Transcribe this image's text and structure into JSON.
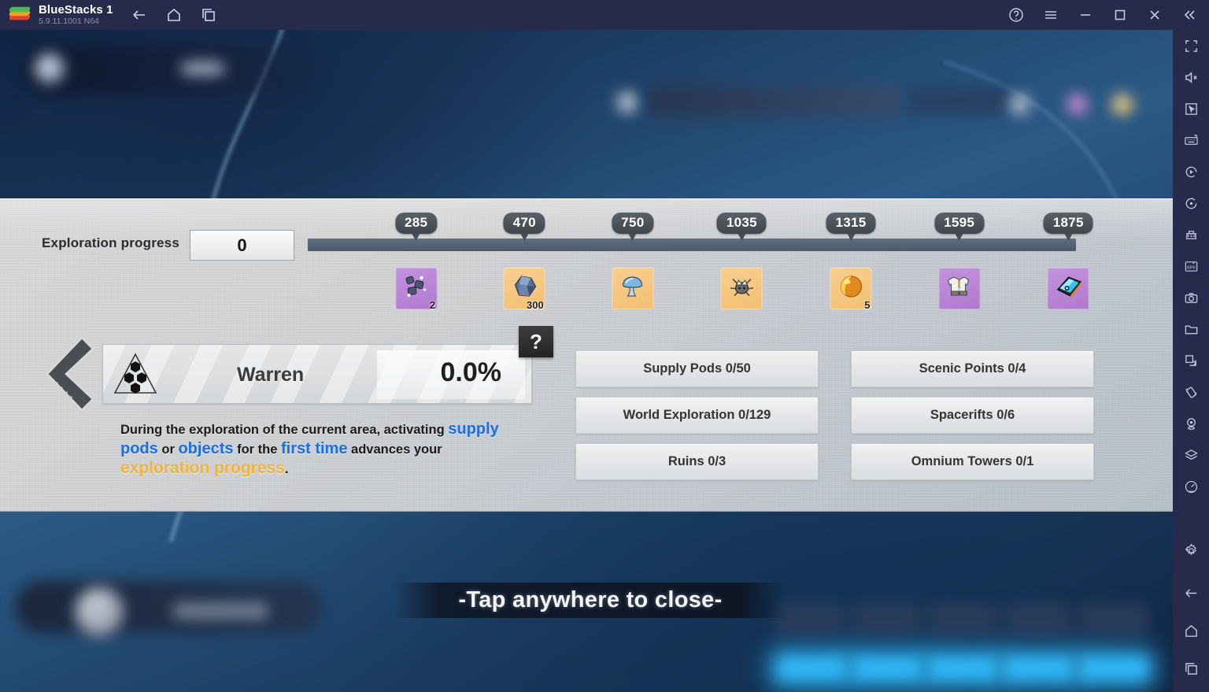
{
  "titlebar": {
    "app_name": "BlueStacks 1",
    "version": "5.9.11.1001 N64",
    "nav": [
      {
        "name": "back-icon",
        "label": "Back"
      },
      {
        "name": "home-icon",
        "label": "Home"
      },
      {
        "name": "recents-icon",
        "label": "Recent apps"
      }
    ],
    "controls": [
      {
        "name": "help-icon",
        "label": "Help"
      },
      {
        "name": "menu-icon",
        "label": "Menu"
      },
      {
        "name": "minimize-icon",
        "label": "Minimize"
      },
      {
        "name": "maximize-icon",
        "label": "Maximize"
      },
      {
        "name": "close-icon",
        "label": "Close"
      },
      {
        "name": "collapse-sidebar-icon",
        "label": "Collapse"
      }
    ]
  },
  "sidebar": {
    "items": [
      {
        "name": "fullscreen-icon",
        "label": "Fullscreen"
      },
      {
        "name": "mute-icon",
        "label": "Mute"
      },
      {
        "name": "cursor-icon",
        "label": "Cursor"
      },
      {
        "name": "keyboard-controls-icon",
        "label": "Game controls"
      },
      {
        "name": "macro-recorder-icon",
        "label": "Macro recorder"
      },
      {
        "name": "rotate-icon",
        "label": "Rotate"
      },
      {
        "name": "multi-instance-icon",
        "label": "Multi-instance"
      },
      {
        "name": "install-apk-icon",
        "label": "Install APK"
      },
      {
        "name": "screenshot-icon",
        "label": "Screenshot"
      },
      {
        "name": "media-manager-icon",
        "label": "Media manager"
      },
      {
        "name": "copy-icon",
        "label": "Copy to PC"
      },
      {
        "name": "shake-icon",
        "label": "Shake"
      },
      {
        "name": "location-icon",
        "label": "Location"
      },
      {
        "name": "layers-icon",
        "label": "Layers"
      },
      {
        "name": "performance-icon",
        "label": "Performance"
      },
      {
        "name": "settings-icon",
        "label": "Settings"
      },
      {
        "name": "back-icon",
        "label": "Back"
      },
      {
        "name": "home-icon",
        "label": "Home"
      },
      {
        "name": "recents-icon",
        "label": "Recent apps"
      }
    ]
  },
  "panel": {
    "progress": {
      "label": "Exploration progress",
      "value": "0",
      "fill_percent": 0,
      "milestones": [
        {
          "value": "285",
          "left_pct": 14.1
        },
        {
          "value": "470",
          "left_pct": 28.2
        },
        {
          "value": "750",
          "left_pct": 42.3
        },
        {
          "value": "1035",
          "left_pct": 56.5
        },
        {
          "value": "1315",
          "left_pct": 70.7
        },
        {
          "value": "1595",
          "left_pct": 84.8
        },
        {
          "value": "1875",
          "left_pct": 99.0
        }
      ],
      "rewards": [
        {
          "icon": "gem-cluster-icon",
          "rarity": "purple",
          "count": "2",
          "left_pct": 14.1
        },
        {
          "icon": "crystal-ore-icon",
          "rarity": "gold",
          "count": "300",
          "left_pct": 28.2
        },
        {
          "icon": "mushroom-icon",
          "rarity": "gold",
          "count": "",
          "left_pct": 42.3
        },
        {
          "icon": "creature-icon",
          "rarity": "gold",
          "count": "",
          "left_pct": 56.5
        },
        {
          "icon": "orb-icon",
          "rarity": "gold",
          "count": "5",
          "left_pct": 70.7
        },
        {
          "icon": "outfit-icon",
          "rarity": "purple",
          "count": "",
          "left_pct": 84.8
        },
        {
          "icon": "card-pack-icon",
          "rarity": "purple",
          "count": "",
          "left_pct": 99.0
        }
      ]
    },
    "region": {
      "icon": "hex-triangle-icon",
      "name": "Warren",
      "percent": "0.0%",
      "help_badge": "?",
      "back_arrow": "previous-region-arrow"
    },
    "description": {
      "part1": "During the exploration of the current area, activating ",
      "blue1": "supply pods",
      "mid1": " or ",
      "blue2": "objects",
      "mid2": " for the ",
      "blue3": "first time",
      "mid3": " advances your ",
      "gold1": "exploration progress",
      "end": "."
    },
    "stats_left": [
      {
        "label": "Supply Pods 0/50"
      },
      {
        "label": "World Exploration 0/129"
      },
      {
        "label": "Ruins 0/3"
      }
    ],
    "stats_right": [
      {
        "label": "Scenic Points 0/4"
      },
      {
        "label": "Spacerifts 0/6"
      },
      {
        "label": "Omnium Towers 0/1"
      }
    ]
  },
  "overlay": {
    "tap_to_close": "-Tap anywhere to close-"
  },
  "colors": {
    "titlebar": "#272b4b",
    "accent_blue": "#1c6fe0",
    "accent_gold": "#f0b33c",
    "rarity_purple": "#b078cf",
    "rarity_gold": "#f3bf72",
    "track": "#4b5a6b"
  }
}
